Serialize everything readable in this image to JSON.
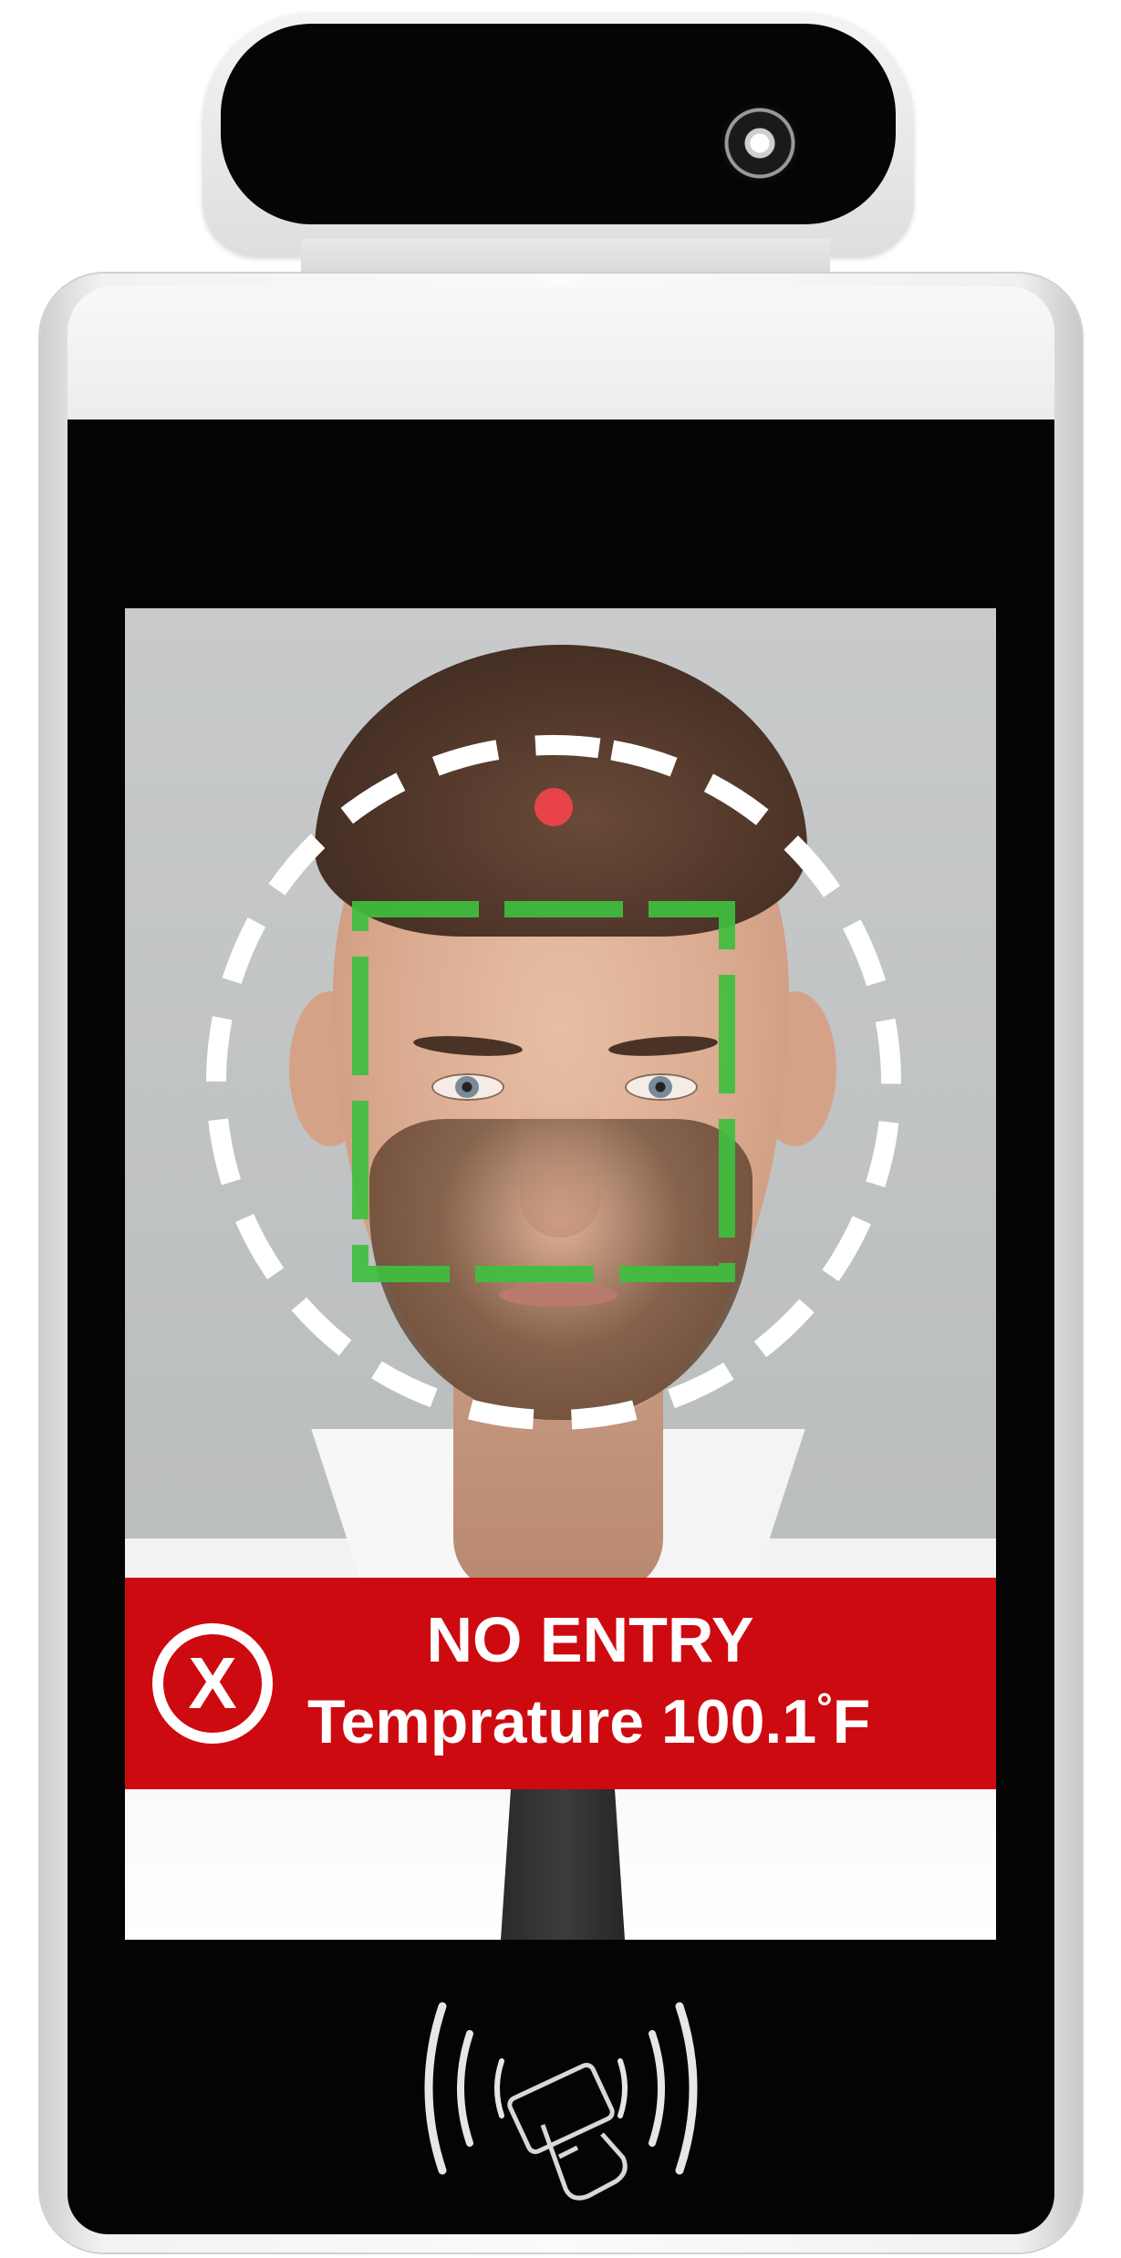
{
  "device": {
    "type": "face recognition temperature kiosk"
  },
  "alert": {
    "title": "NO ENTRY",
    "temperature_label": "Temprature",
    "temperature_value": "100.1",
    "temperature_degree": "°",
    "temperature_unit": "F",
    "icon_glyph": "X",
    "icon": "close-circle-icon",
    "background_color": "#cd0a10",
    "text_color": "#ffffff"
  },
  "overlay": {
    "outer_ring_color": "#ffffff",
    "face_box_color": "#3fbf3f",
    "forehead_dot_color": "#e8434a"
  },
  "icons": {
    "camera": "camera-lens-icon",
    "sensors": "sensor-icon",
    "nfc": "nfc-card-icon"
  }
}
